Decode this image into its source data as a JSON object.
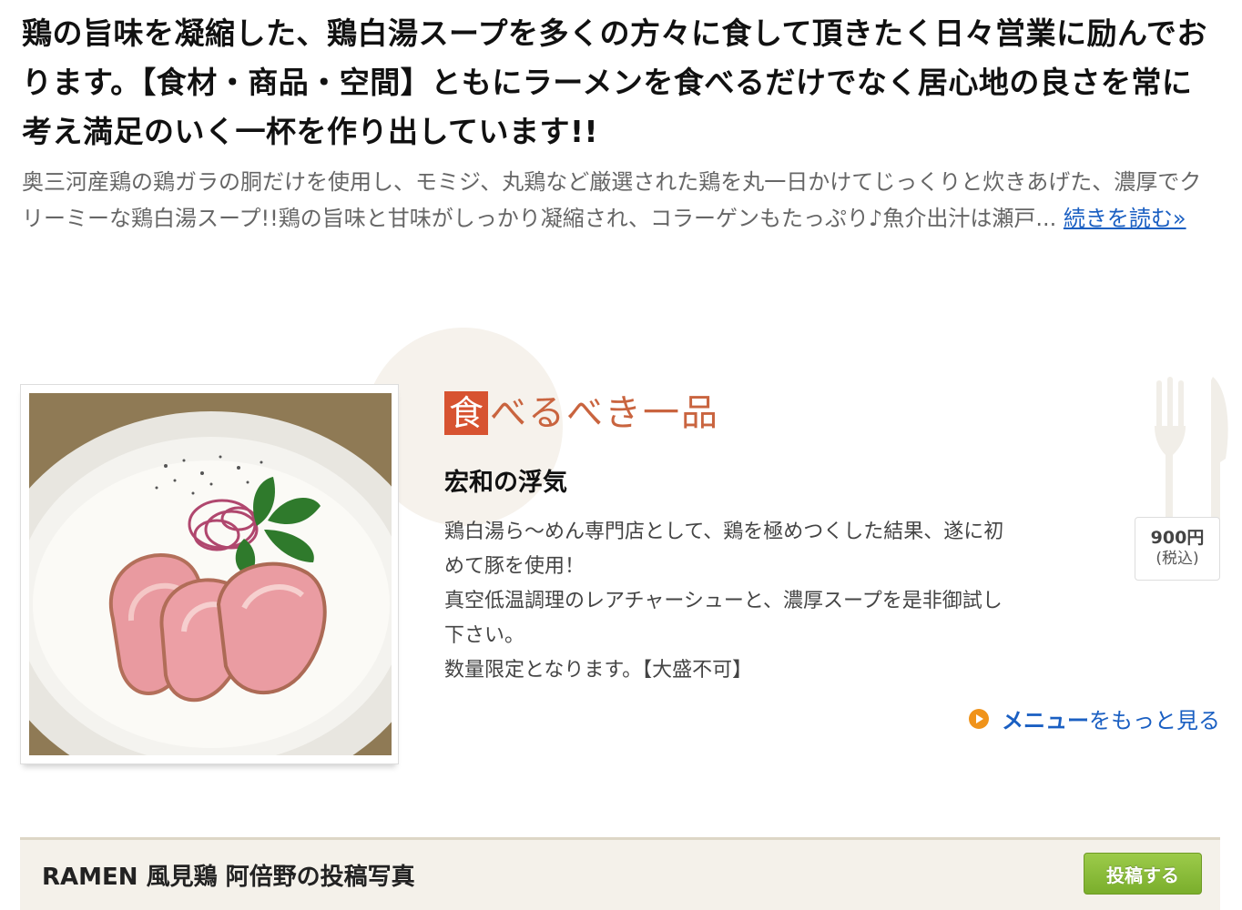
{
  "headline": "鶏の旨味を凝縮した、鶏白湯スープを多くの方々に食して頂きたく日々営業に励んでおります。【食材・商品・空間】ともにラーメンを食べるだけでなく居心地の良さを常に考え満足のいく一杯を作り出しています!!",
  "intro": {
    "text": "奥三河産鶏の鶏ガラの胴だけを使用し、モミジ、丸鶏など厳選された鶏を丸一日かけてじっくりと炊きあげた、濃厚でクリーミーな鶏白湯スープ!!鶏の旨味と甘味がしっかり凝縮され、コラーゲンもたっぷり♪魚介出汁は瀬戸... ",
    "read_more": "続きを読む»"
  },
  "featured": {
    "badge_kanji": "食",
    "badge_text": "べるべき一品",
    "name": "宏和の浮気",
    "description": [
      "鶏白湯ら〜めん専門店として、鶏を極めつくした結果、遂に初",
      "めて豚を使用！",
      "真空低温調理のレアチャーシューと、濃厚スープを是非御試し",
      "下さい。",
      "数量限定となります。【大盛不可】"
    ],
    "price": "900円",
    "tax_note": "(税込)",
    "more_link_strong": "メニュー",
    "more_link_rest": "をもっと見る"
  },
  "posts": {
    "title": "RAMEN 風見鶏 阿倍野の投稿写真",
    "button_label": "投稿する"
  },
  "colors": {
    "link": "#1a5fc2",
    "badge_red": "#d75331",
    "accent_orange": "#f0931a",
    "button_green": "#86b935"
  }
}
